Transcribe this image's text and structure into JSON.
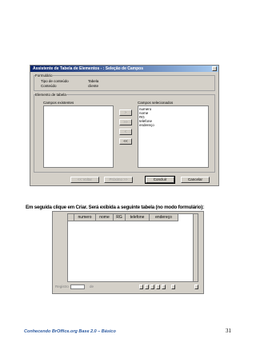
{
  "dialog": {
    "title": "Assistente de Tabela de Elementos - : Seleção de Campos",
    "form_group": {
      "title": "Formulário",
      "rows": [
        {
          "label": "Tipo de conteúdo",
          "value": "Tabela"
        },
        {
          "label": "Conteúdo",
          "value": "cliente"
        }
      ]
    },
    "table_group": {
      "title": "Elemento de tabela",
      "available_label": "Campos existentes",
      "selected_label": "Campos selecionados",
      "selected_fields": [
        "numero",
        "nome",
        "RG",
        "telefone",
        "endereço"
      ]
    },
    "move_buttons": [
      ">",
      ">>",
      "<",
      "<<"
    ],
    "buttons": {
      "back": "<< Voltar",
      "next": "Próximo >>",
      "finish": "Concluir",
      "cancel": "Cancelar"
    }
  },
  "caption": "Em seguida clique em Criar. Será exibida a seguinte tabela (no modo formulário):",
  "form_view": {
    "columns": [
      "numero",
      "nome",
      "RG",
      "telefone",
      "endereço"
    ],
    "record_label": "Registro",
    "of_label": "de"
  },
  "footer": "Conhecendo BrOffice.org Base 2.0 – Básico",
  "page_number": "31"
}
